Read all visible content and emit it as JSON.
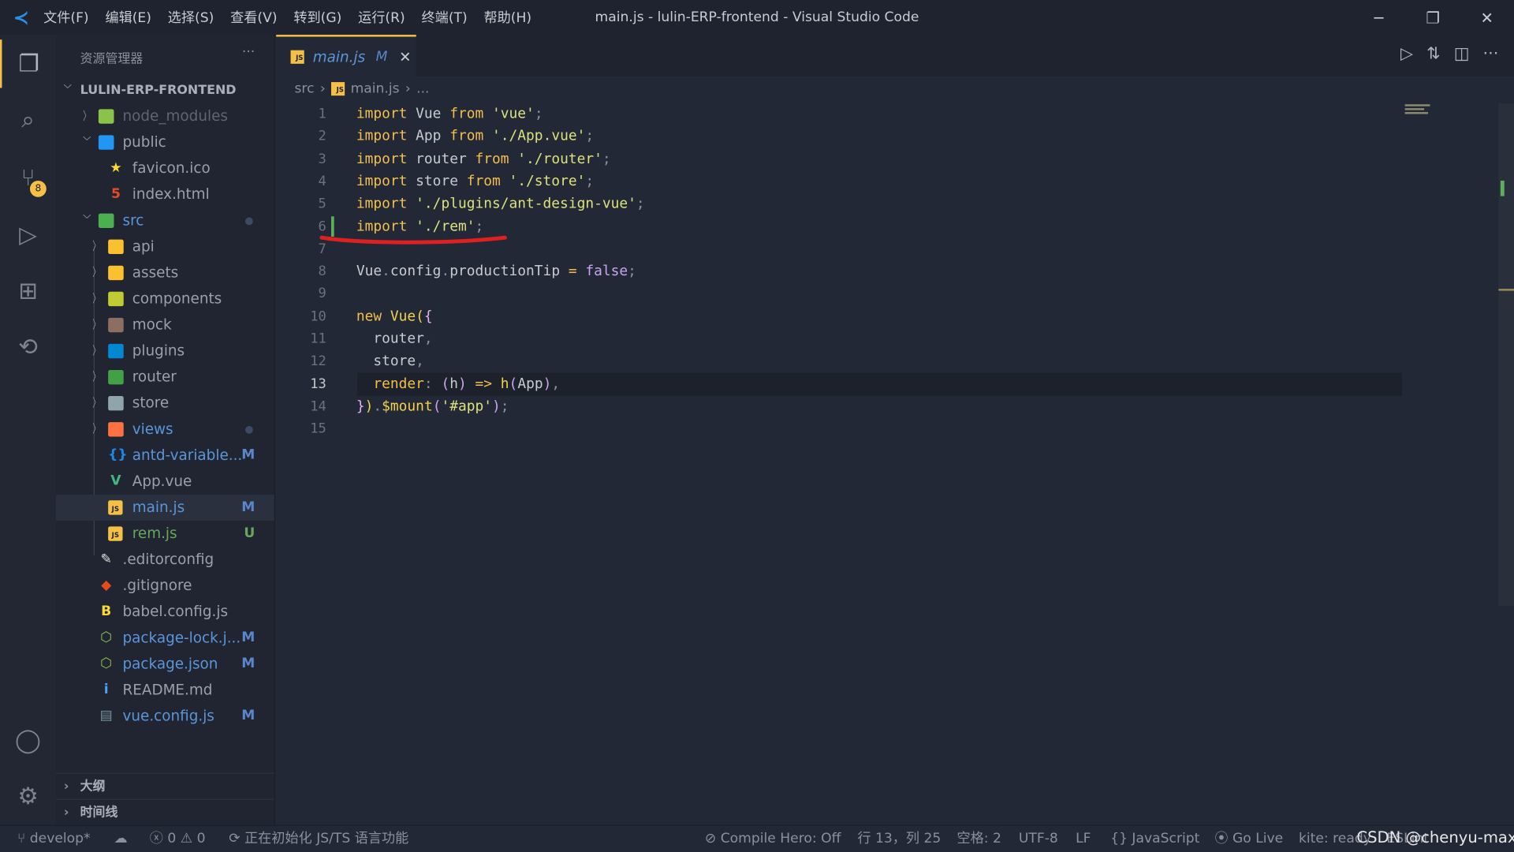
{
  "window": {
    "title": "main.js - lulin-ERP-frontend - Visual Studio Code",
    "menu": [
      "文件(F)",
      "编辑(E)",
      "选择(S)",
      "查看(V)",
      "转到(G)",
      "运行(R)",
      "终端(T)",
      "帮助(H)"
    ],
    "controls": [
      "─",
      "❐",
      "✕"
    ]
  },
  "activity_bar": {
    "scm_badge": "8",
    "items": [
      "explorer-icon",
      "search-icon",
      "source-control-icon",
      "run-debug-icon",
      "extensions-icon",
      "remote-icon",
      "account-icon",
      "settings-gear-icon"
    ]
  },
  "sidebar": {
    "title": "资源管理器",
    "more": "···",
    "project": "LULIN-ERP-FRONTEND",
    "items": [
      {
        "name": "node_modules",
        "level": 1,
        "folder": true,
        "expanded": false,
        "icon": "node-folder-icon",
        "iconColor": "#8bc34a",
        "color": "#5f6574"
      },
      {
        "name": "public",
        "level": 1,
        "folder": true,
        "expanded": true,
        "icon": "public-folder-icon",
        "iconColor": "#2196f3",
        "color": "#9aa0ac"
      },
      {
        "name": "favicon.ico",
        "level": 2,
        "icon": "star-icon",
        "iconColor": "#fdd835",
        "color": "#9aa0ac"
      },
      {
        "name": "index.html",
        "level": 2,
        "icon": "html5-icon",
        "iconColor": "#e44d26",
        "color": "#9aa0ac"
      },
      {
        "name": "src",
        "level": 1,
        "folder": true,
        "expanded": true,
        "icon": "src-folder-icon",
        "iconColor": "#4caf50",
        "color": "#5b96d9",
        "dot": true
      },
      {
        "name": "api",
        "level": 2,
        "folder": true,
        "expanded": false,
        "icon": "api-folder-icon",
        "iconColor": "#fbc02d",
        "color": "#9aa0ac"
      },
      {
        "name": "assets",
        "level": 2,
        "folder": true,
        "expanded": false,
        "icon": "assets-folder-icon",
        "iconColor": "#fbc02d",
        "color": "#9aa0ac"
      },
      {
        "name": "components",
        "level": 2,
        "folder": true,
        "expanded": false,
        "icon": "components-folder-icon",
        "iconColor": "#c0ca33",
        "color": "#9aa0ac"
      },
      {
        "name": "mock",
        "level": 2,
        "folder": true,
        "expanded": false,
        "icon": "mock-folder-icon",
        "iconColor": "#8d6e63",
        "color": "#9aa0ac"
      },
      {
        "name": "plugins",
        "level": 2,
        "folder": true,
        "expanded": false,
        "icon": "plugins-folder-icon",
        "iconColor": "#0288d1",
        "color": "#9aa0ac"
      },
      {
        "name": "router",
        "level": 2,
        "folder": true,
        "expanded": false,
        "icon": "router-folder-icon",
        "iconColor": "#43a047",
        "color": "#9aa0ac"
      },
      {
        "name": "store",
        "level": 2,
        "folder": true,
        "expanded": false,
        "icon": "store-folder-icon",
        "iconColor": "#90a4ae",
        "color": "#9aa0ac"
      },
      {
        "name": "views",
        "level": 2,
        "folder": true,
        "expanded": false,
        "icon": "views-folder-icon",
        "iconColor": "#ff7043",
        "color": "#5b96d9",
        "dot": true
      },
      {
        "name": "antd-variable...",
        "level": 2,
        "icon": "json-braces-icon",
        "iconColor": "#1e88e5",
        "color": "#5b96d9",
        "status": "M"
      },
      {
        "name": "App.vue",
        "level": 2,
        "icon": "vue-icon",
        "iconColor": "#41b883",
        "color": "#9aa0ac"
      },
      {
        "name": "main.js",
        "level": 2,
        "icon": "js-icon",
        "iconColor": "#f5c046",
        "color": "#5b96d9",
        "status": "M",
        "selected": true
      },
      {
        "name": "rem.js",
        "level": 2,
        "icon": "js-icon",
        "iconColor": "#f5c046",
        "color": "#67a85a",
        "status": "U",
        "statusColor": "#67a85a"
      },
      {
        "name": ".editorconfig",
        "level": 1,
        "icon": "editorconfig-icon",
        "iconColor": "#e0e0e0",
        "color": "#9aa0ac"
      },
      {
        "name": ".gitignore",
        "level": 1,
        "icon": "git-icon",
        "iconColor": "#e64a19",
        "color": "#9aa0ac"
      },
      {
        "name": "babel.config.js",
        "level": 1,
        "icon": "babel-icon",
        "iconColor": "#fdd835",
        "color": "#9aa0ac"
      },
      {
        "name": "package-lock.j...",
        "level": 1,
        "icon": "nodejs-icon",
        "iconColor": "#8bc34a",
        "color": "#5b96d9",
        "status": "M"
      },
      {
        "name": "package.json",
        "level": 1,
        "icon": "nodejs-icon",
        "iconColor": "#8bc34a",
        "color": "#5b96d9",
        "status": "M"
      },
      {
        "name": "README.md",
        "level": 1,
        "icon": "info-icon",
        "iconColor": "#42a5f5",
        "color": "#9aa0ac"
      },
      {
        "name": "vue.config.js",
        "level": 1,
        "icon": "vue-config-icon",
        "iconColor": "#78909c",
        "color": "#5b96d9",
        "status": "M"
      }
    ],
    "panels": [
      "大纲",
      "时间线"
    ]
  },
  "tab": {
    "label": "main.js",
    "modified": "M",
    "icon": "js-icon",
    "close": "✕"
  },
  "breadcrumb": {
    "folder": "src",
    "file": "main.js",
    "rest": "..."
  },
  "editor": {
    "current_line": 13,
    "added_line": 6,
    "lines": [
      [
        [
          "import ",
          "k"
        ],
        [
          "Vue ",
          "v"
        ],
        [
          "from ",
          "k"
        ],
        [
          "'vue'",
          "s"
        ],
        [
          ";",
          "o"
        ]
      ],
      [
        [
          "import ",
          "k"
        ],
        [
          "App ",
          "v"
        ],
        [
          "from ",
          "k"
        ],
        [
          "'./App.vue'",
          "s"
        ],
        [
          ";",
          "o"
        ]
      ],
      [
        [
          "import ",
          "k"
        ],
        [
          "router ",
          "v"
        ],
        [
          "from ",
          "k"
        ],
        [
          "'./router'",
          "s"
        ],
        [
          ";",
          "o"
        ]
      ],
      [
        [
          "import ",
          "k"
        ],
        [
          "store ",
          "v"
        ],
        [
          "from ",
          "k"
        ],
        [
          "'./store'",
          "s"
        ],
        [
          ";",
          "o"
        ]
      ],
      [
        [
          "import ",
          "k"
        ],
        [
          "'./plugins/ant-design-vue'",
          "s"
        ],
        [
          ";",
          "o"
        ]
      ],
      [
        [
          "import ",
          "k"
        ],
        [
          "'./rem'",
          "s"
        ],
        [
          ";",
          "o"
        ]
      ],
      [],
      [
        [
          "Vue",
          "v"
        ],
        [
          ".",
          "o"
        ],
        [
          "config",
          "v"
        ],
        [
          ".",
          "o"
        ],
        [
          "productionTip ",
          "v"
        ],
        [
          "= ",
          "k"
        ],
        [
          "false",
          "f"
        ],
        [
          ";",
          "o"
        ]
      ],
      [],
      [
        [
          "new ",
          "k"
        ],
        [
          "Vue",
          "p"
        ],
        [
          "(",
          "p"
        ],
        [
          "{",
          "b"
        ]
      ],
      [
        [
          "  router",
          "v"
        ],
        [
          ",",
          "o"
        ]
      ],
      [
        [
          "  store",
          "v"
        ],
        [
          ",",
          "o"
        ]
      ],
      [
        [
          "  render",
          "k"
        ],
        [
          ": ",
          "o"
        ],
        [
          "(",
          "f"
        ],
        [
          "h",
          "v"
        ],
        [
          ") ",
          "f"
        ],
        [
          "=> ",
          "k"
        ],
        [
          "h",
          "p"
        ],
        [
          "(",
          "f"
        ],
        [
          "App",
          "v"
        ],
        [
          ")",
          "f"
        ],
        [
          ",",
          "o"
        ]
      ],
      [
        [
          "}",
          "b"
        ],
        [
          ")",
          "p"
        ],
        [
          ".",
          "o"
        ],
        [
          "$mount",
          "p"
        ],
        [
          "(",
          "f"
        ],
        [
          "'#app'",
          "s"
        ],
        [
          ")",
          "f"
        ],
        [
          ";",
          "o"
        ]
      ],
      []
    ]
  },
  "status": {
    "branch": "develop*",
    "errors": "0",
    "warnings": "0",
    "task": "正在初始化 JS/TS 语言功能",
    "compile_hero": "Compile Hero: Off",
    "position": "行 13，列 25",
    "spaces": "空格: 2",
    "encoding": "UTF-8",
    "eol": "LF",
    "language": "JavaScript",
    "golive": "Go Live",
    "kite": "kite: ready",
    "eslint": "ESLint"
  },
  "watermark": "CSDN @chenyu-max",
  "colors": {
    "accent": "#f5c046",
    "annotation": "#e02020"
  }
}
